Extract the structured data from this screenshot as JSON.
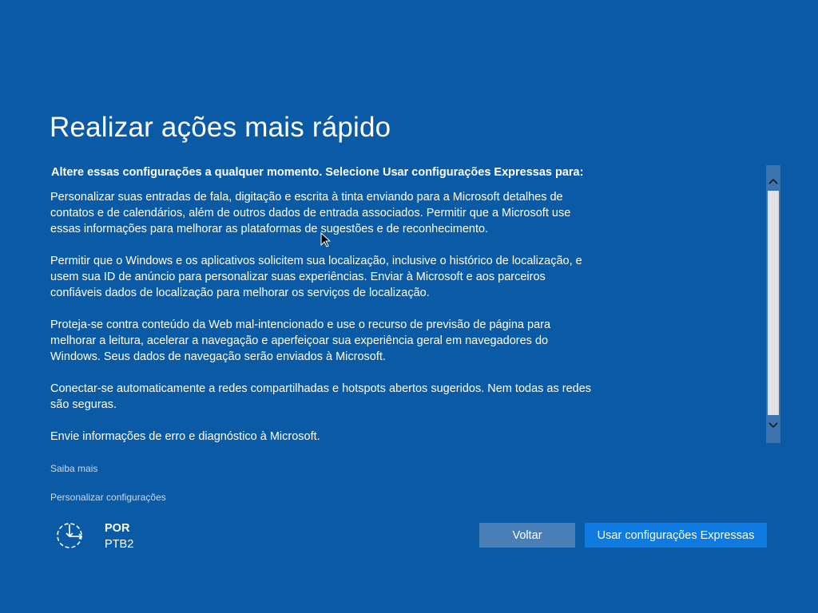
{
  "header": {
    "title": "Realizar ações mais rápido"
  },
  "content": {
    "intro": "Altere essas configurações a qualquer momento. Selecione Usar configurações Expressas para:",
    "paragraphs": [
      "Personalizar suas entradas de fala, digitação e escrita à tinta enviando para a Microsoft detalhes de contatos e de calendários, além de outros dados de entrada associados. Permitir que a Microsoft use essas informações para melhorar as plataformas de sugestões e de reconhecimento.",
      "Permitir que o Windows e os aplicativos solicitem sua localização, inclusive o histórico de localização, e usem sua ID de anúncio para personalizar suas experiências. Enviar à Microsoft e aos parceiros confiáveis dados de localização para melhorar os serviços de localização.",
      "Proteja-se contra conteúdo da Web mal-intencionado e use o recurso de previsão de página para melhorar a leitura, acelerar a navegação e aperfeiçoar sua experiência geral em navegadores do Windows. Seus dados de navegação serão enviados à Microsoft.",
      "Conectar-se automaticamente a redes compartilhadas e hotspots abertos sugeridos. Nem todas as redes são seguras.",
      "Envie informações de erro e diagnóstico à Microsoft."
    ]
  },
  "links": {
    "learn_more": "Saiba mais",
    "customize": "Personalizar configurações"
  },
  "language": {
    "icon": "accessibility-ease-of-access-icon",
    "code": "POR",
    "layout": "PTB2"
  },
  "buttons": {
    "back": "Voltar",
    "express": "Usar configurações Expressas"
  },
  "colors": {
    "background": "#0b5aa6",
    "primary_button": "#0f7ae0",
    "secondary_button": "#4a7eb6"
  }
}
